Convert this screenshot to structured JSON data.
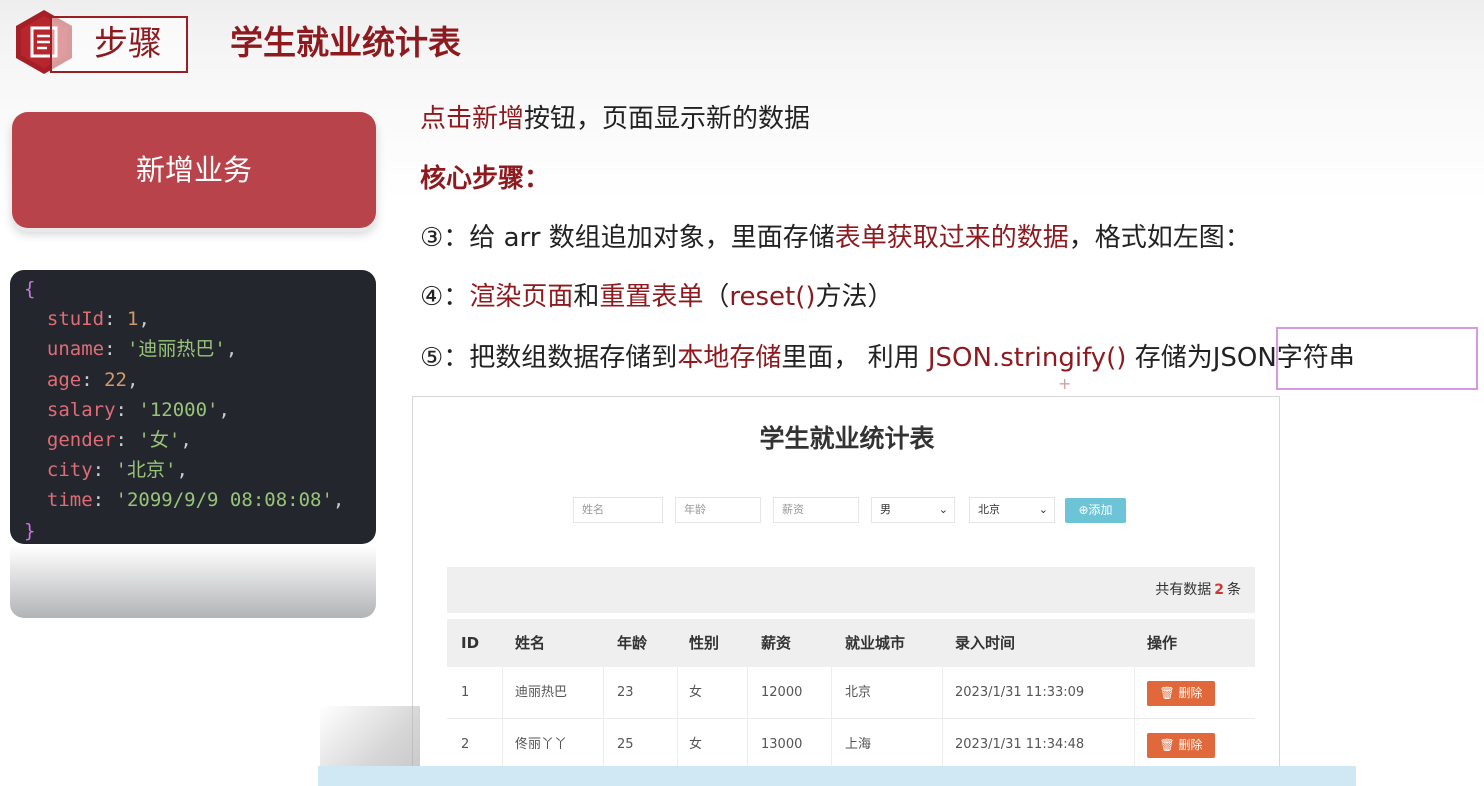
{
  "header": {
    "step_label": "步骤",
    "title": "学生就业统计表"
  },
  "card": {
    "label": "新增业务"
  },
  "code": {
    "open": "{",
    "close": "}",
    "lines": [
      {
        "key": "stuId",
        "value": "1",
        "kind": "num"
      },
      {
        "key": "uname",
        "value": "'迪丽热巴'",
        "kind": "str"
      },
      {
        "key": "age",
        "value": "22",
        "kind": "num"
      },
      {
        "key": "salary",
        "value": "'12000'",
        "kind": "str"
      },
      {
        "key": "gender",
        "value": "'女'",
        "kind": "str"
      },
      {
        "key": "city",
        "value": "'北京'",
        "kind": "str"
      },
      {
        "key": "time",
        "value": "'2099/9/9 08:08:08'",
        "kind": "str"
      }
    ]
  },
  "text": {
    "l1_red": "点击新增",
    "l1_rest": "按钮，页面显示新的数据",
    "l2": "核心步骤：",
    "l3_a": "③：给 arr 数组追加对象，里面存储",
    "l3_red": "表单获取过来的数据",
    "l3_b": "，格式如左图：",
    "l4_a": "④：",
    "l4_red1": "渲染页面",
    "l4_b": "和",
    "l4_red2": "重置表单",
    "l4_c": "（",
    "l4_red3": "reset()",
    "l4_d": "方法）",
    "l5_a": "⑤：把数组数据存储到",
    "l5_red1": "本地存储",
    "l5_b": "里面， 利用 ",
    "l5_red2": "JSON.stringify()",
    "l5_c": " 存储为JSON字符串"
  },
  "shot": {
    "title": "学生就业统计表",
    "form": {
      "name_placeholder": "姓名",
      "age_placeholder": "年龄",
      "salary_placeholder": "薪资",
      "gender_value": "男",
      "city_value": "北京",
      "add_label": "⊕添加"
    },
    "total_prefix": "共有数据",
    "total_count": "2",
    "total_suffix": "条",
    "columns": [
      "ID",
      "姓名",
      "年龄",
      "性别",
      "薪资",
      "就业城市",
      "录入时间",
      "操作"
    ],
    "rows": [
      [
        "1",
        "迪丽热巴",
        "23",
        "女",
        "12000",
        "北京",
        "2023/1/31 11:33:09"
      ],
      [
        "2",
        "佟丽丫丫",
        "25",
        "女",
        "13000",
        "上海",
        "2023/1/31 11:34:48"
      ]
    ],
    "delete_label": "🗑 删除"
  },
  "colors": {
    "brand_red": "#8d1a1f",
    "card_bg": "#b8434a",
    "add_button": "#6cc4d6",
    "delete_button": "#e0683a",
    "highlight_border": "#d59ae3"
  },
  "icons": {
    "header": "document-icon",
    "delete": "trash-icon",
    "add": "plus-circle-icon"
  }
}
